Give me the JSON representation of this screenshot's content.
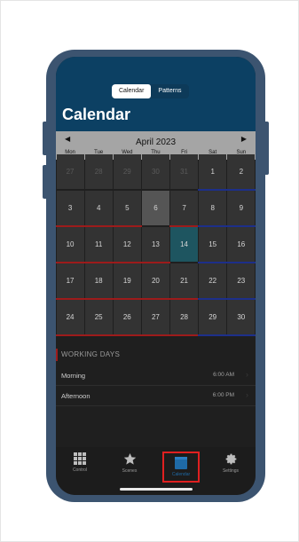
{
  "segmented": {
    "active": "Calendar",
    "inactive": "Patterns"
  },
  "header": {
    "title": "Calendar"
  },
  "calendar": {
    "month_label": "April 2023",
    "prev_arrow": "◀",
    "next_arrow": "▶",
    "weekdays": [
      "Mon",
      "Tue",
      "Wed",
      "Thu",
      "Fri",
      "Sat",
      "Sun"
    ],
    "weeks": [
      [
        "27",
        "28",
        "29",
        "30",
        "31",
        "1",
        "2"
      ],
      [
        "3",
        "4",
        "5",
        "6",
        "7",
        "8",
        "9"
      ],
      [
        "10",
        "11",
        "12",
        "13",
        "14",
        "15",
        "16"
      ],
      [
        "17",
        "18",
        "19",
        "20",
        "21",
        "22",
        "23"
      ],
      [
        "24",
        "25",
        "26",
        "27",
        "28",
        "29",
        "30"
      ]
    ]
  },
  "working_days": {
    "section_title": "WORKING DAYS",
    "rows": [
      {
        "label": "Morning",
        "time": "6:00 AM"
      },
      {
        "label": "Afternoon",
        "time": "6:00 PM"
      }
    ]
  },
  "tabs": [
    {
      "label": "Control",
      "icon": "grid-icon"
    },
    {
      "label": "Scenes",
      "icon": "star-icon"
    },
    {
      "label": "Calendar",
      "icon": "calendar-icon"
    },
    {
      "label": "Settings",
      "icon": "gear-icon"
    }
  ],
  "colors": {
    "header_bg": "#0c4063",
    "month_bar_bg": "#a5a5a5",
    "weekday_line": "#9d1b1b",
    "weekend_line": "#1d2f8a",
    "today_bg": "#1e5560",
    "highlight_border": "#e02020"
  }
}
